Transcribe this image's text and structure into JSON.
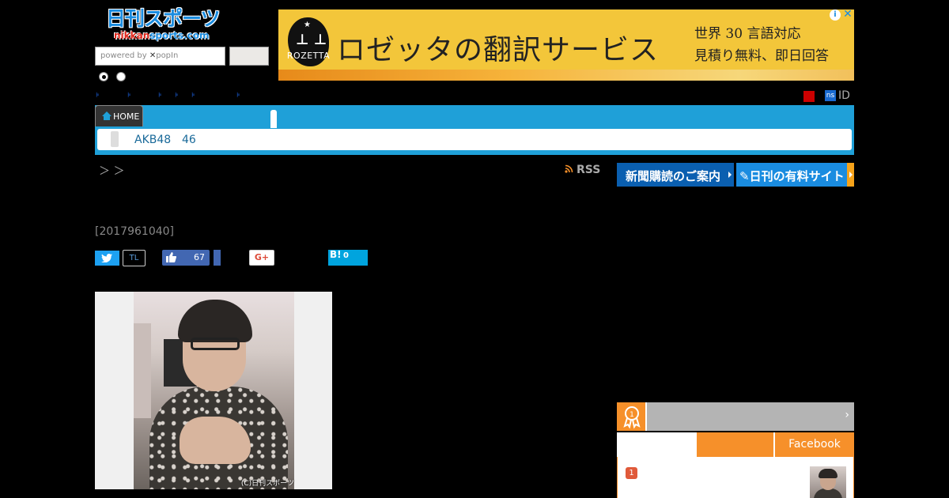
{
  "header": {
    "logo_text": "日刊スポーツ",
    "logo_sub_1": "nikkan",
    "logo_sub_2": "sports.com",
    "search_placeholder_prefix": "powered by",
    "search_placeholder_brand": "popIn"
  },
  "ad": {
    "brand": "ROZETTA",
    "headline": "ロゼッタの翻訳サービス",
    "sub_line_1": "世界 30 言語対応",
    "sub_line_2": "見積り無料、即日回答",
    "info_icon": "info-icon",
    "close_icon": "close-icon"
  },
  "account": {
    "ns_badge": "ns",
    "id_label": "ID"
  },
  "nav": {
    "home_label": "HOME",
    "sub_items": [
      "AKB48",
      "46"
    ]
  },
  "breadcrumb": {
    "separators": "＞ ＞"
  },
  "toolbar": {
    "rss_label": "RSS",
    "subscribe_label": "新聞購読のご案内",
    "paid_site_label": "日刊の有料サイト"
  },
  "article": {
    "id_text": "[2017961040]"
  },
  "share": {
    "tl_label": "TL",
    "like_count": "67",
    "gplus_label": "G+",
    "hatena_label": "B!",
    "hatena_count": "0"
  },
  "photo": {
    "credit": "(C)日刊スポーツ"
  },
  "ranking": {
    "facebook_tab": "Facebook",
    "first_rank": "1"
  },
  "colors": {
    "nav_blue": "#1fa0d8",
    "orange": "#f6902a",
    "subscribe_blue": "#0a5fb0"
  }
}
